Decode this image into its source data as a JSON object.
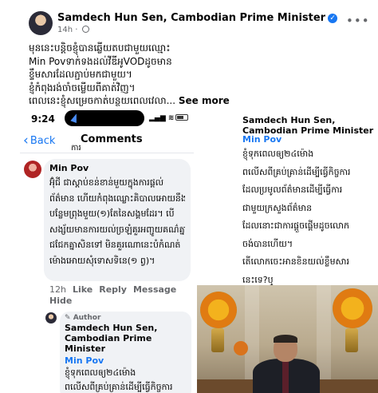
{
  "post": {
    "author": "Samdech Hun Sen, Cambodian Prime Minister",
    "time": "14h",
    "lines": [
      "មុននេះបន្តិចខ្ញុំបានឆ្លើយតបជាមួយឈ្មោះ",
      "Min Povទាក់ទងដល់វីឌីអូVODដូចមាន",
      "ខ្ទឹមសារដែលភ្ជាប់មកជាមួយ។",
      "ខ្ញុំកំពុងរង់ចាំចម្លើយពីគាត់វិញ។",
      "ពេលនេះខ្ញុំសម្រេចកាត់បន្ថយពេលវេលា..."
    ],
    "see_more": "See more"
  },
  "phone": {
    "status_time": "9:24",
    "back_label": "Back",
    "title": "Comments",
    "cut_text": "ការ",
    "comment": {
      "name": "Min Pov",
      "lines": [
        "អ៊ុំជី ជាស្ដាប់ខន់ខាន់មួយក្នុងការផ្ដល់",
        "ព័ត៌មាន ហើយកំពុងឈ្លោះគិបាលអោយនឹង",
        "បន្លែមព្រុងមួយ(១)តែនៃសង្គមដែរ។ បើ",
        "សង្ស័យមានការយល់ច្រឡំគួរអញ្ជូយគណ៌គ្នា",
        "ជជែកគ្នាសិនទៅ មិនគួរណោនេះបំកំណត់",
        "ម៉ោងអោយសុំទោសទិនេ(១ ព្វ)។"
      ],
      "time": "12h",
      "like": "Like",
      "reply": "Reply",
      "message": "Message",
      "hide": "Hide"
    },
    "reply": {
      "badge": "Author",
      "name": "Samdech Hun Sen, Cambodian Prime Minister",
      "mention": "Min Pov",
      "lines": [
        "ខ្ញុំទុកពេលឲ្យ២៤ម៉ោង",
        "ពលើសពីគ្រប់គ្រាន់ដើម្បីធ្វើកិច្ចការ"
      ]
    }
  },
  "right_panel": {
    "name": "Samdech Hun Sen, Cambodian Prime Minister",
    "mention": "Min Pov",
    "lines": [
      "ខ្ញុំទុកពេលឲ្យ២៤ម៉ោង",
      "ពលើសពីគ្រប់គ្រាន់ដើម្បីធ្វើកិច្ចការ",
      "ដែលប្រមូលព័ត៌មានដើម្បីធ្វើការ",
      "ជាមួយក្រសួងព័ត៌មាន",
      "ដែលនោះជាការផ្ដួចផ្ដើមដូចលោក",
      "ចង់បានហើយ។",
      "តើលោកចេះអានខិនយល់ខ្លឹមសារ",
      "នេះទេ?ឬ"
    ]
  },
  "colors": {
    "brand_blue": "#1877f2",
    "bubble_bg": "#f0f2f5",
    "meta_gray": "#65676b"
  },
  "icons": [
    "verified-icon",
    "globe-icon",
    "more-icon",
    "back-chevron-icon",
    "battery-icon",
    "navigation-arrow-icon"
  ]
}
